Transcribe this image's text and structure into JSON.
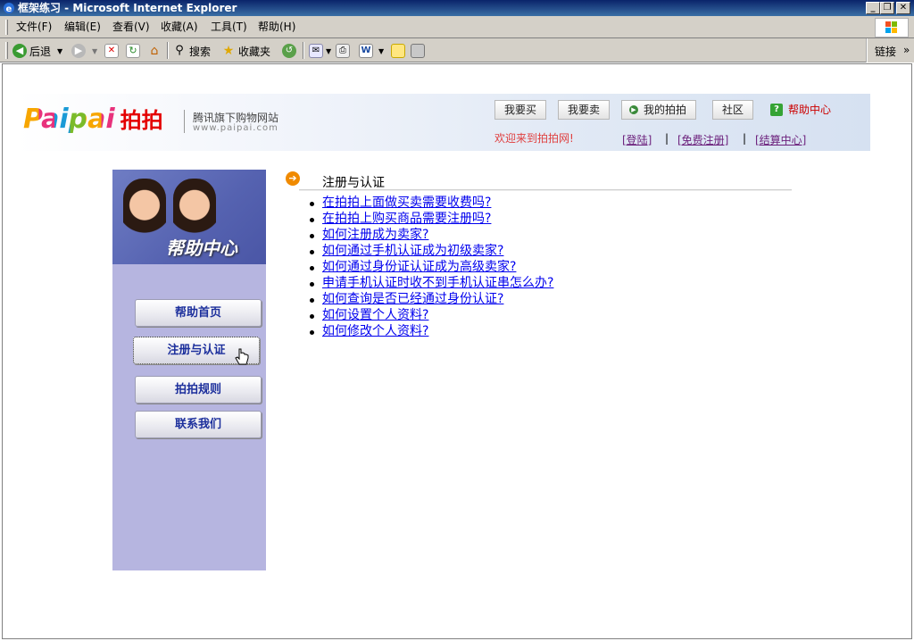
{
  "window": {
    "title": "框架练习 - Microsoft Internet Explorer",
    "controls": [
      "_",
      "❐",
      "✕"
    ]
  },
  "menu": [
    "文件(F)",
    "编辑(E)",
    "查看(V)",
    "收藏(A)",
    "工具(T)",
    "帮助(H)"
  ],
  "toolbar": {
    "back": "后退",
    "search": "搜索",
    "favorites": "收藏夹",
    "links": "链接"
  },
  "header": {
    "logo_latin": "Paipai",
    "logo_cn": "拍拍",
    "tagline": "腾讯旗下购物网站",
    "site": "www.paipai.com",
    "nav": [
      "我要买",
      "我要卖",
      "我的拍拍",
      "社区"
    ],
    "help_center": "帮助中心",
    "welcome": "欢迎来到拍拍网!",
    "links": [
      "[登陆]",
      "[免费注册]",
      "[结算中心]"
    ],
    "link_sep": "|"
  },
  "sidebar": {
    "title": "帮助中心",
    "buttons": [
      "帮助首页",
      "注册与认证",
      "拍拍规则",
      "联系我们"
    ],
    "active_index": 1
  },
  "content": {
    "title": "注册与认证",
    "questions": [
      "在拍拍上面做买卖需要收费吗?",
      "在拍拍上购买商品需要注册吗?",
      "如何注册成为卖家?",
      "如何通过手机认证成为初级卖家?",
      "如何通过身份证认证成为高级卖家?",
      "申请手机认证时收不到手机认证串怎么办?",
      "如何查询是否已经通过身份认证?",
      "如何设置个人资料?",
      "如何修改个人资料?"
    ]
  },
  "colors": {
    "titlebar": "#0a246a",
    "sidebar": "#b6b5e0",
    "link": "#0000ee",
    "accent": "#f08a00"
  }
}
